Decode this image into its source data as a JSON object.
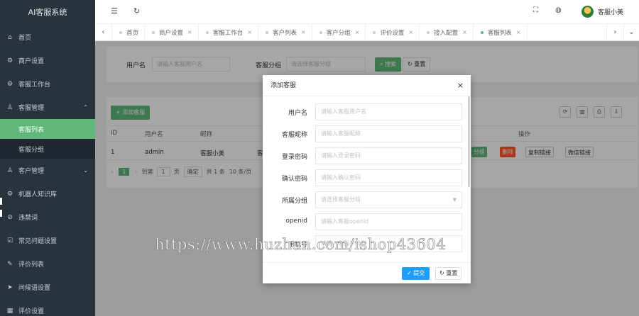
{
  "app": {
    "logo": "AI客服系统"
  },
  "sidebar": {
    "items": [
      {
        "icon": "⌂",
        "label": "首页"
      },
      {
        "icon": "⚙",
        "label": "商户设置"
      },
      {
        "icon": "⚙",
        "label": "客服工作台"
      },
      {
        "icon": "♙",
        "label": "客服管理",
        "arrow": "⌃"
      }
    ],
    "sub": [
      {
        "label": "客服列表"
      },
      {
        "label": "客服分组"
      }
    ],
    "items2": [
      {
        "icon": "♙",
        "label": "客户管理",
        "arrow": "⌄"
      },
      {
        "icon": "⚙",
        "label": "机器人知识库"
      },
      {
        "icon": "⊘",
        "label": "违禁词"
      },
      {
        "icon": "☑",
        "label": "常见问题设置"
      },
      {
        "icon": "✎",
        "label": "评价列表"
      },
      {
        "icon": "➤",
        "label": "问候语设置"
      },
      {
        "icon": "▦",
        "label": "评价设置"
      }
    ]
  },
  "header": {
    "menu_icon": "☰",
    "refresh_icon": "↻",
    "fullscreen_icon": "⛶",
    "globe_icon": "◍",
    "user_name": "客服小美"
  },
  "tabs": {
    "prev": "‹",
    "next": "›",
    "down": "⌄",
    "items": [
      {
        "label": "首页",
        "close": ""
      },
      {
        "label": "商户设置",
        "close": "×"
      },
      {
        "label": "客服工作台",
        "close": "×"
      },
      {
        "label": "客户列表",
        "close": "×"
      },
      {
        "label": "客户分组",
        "close": "×"
      },
      {
        "label": "评价设置",
        "close": "×"
      },
      {
        "label": "接入配置",
        "close": "×"
      },
      {
        "label": "客服列表",
        "close": "×"
      }
    ]
  },
  "search": {
    "username_label": "用户名",
    "username_placeholder": "请输入客服用户名",
    "group_label": "客服分组",
    "group_placeholder": "请选择客服分组",
    "search_button": "搜索",
    "reset_button": "重置"
  },
  "table": {
    "add_button": "+ 添加客服",
    "tools": [
      "⟳",
      "▥",
      "⎙",
      "⇩"
    ],
    "headers": {
      "id": "ID",
      "username": "用户名",
      "nickname": "昵称",
      "ops": "操作"
    },
    "row": {
      "id": "1",
      "username": "admin",
      "nickname": "客服小美",
      "partial": "客"
    },
    "ops": {
      "btn1": "分组",
      "delete": "删除",
      "copy": "复制链接",
      "copy2": "微信链接"
    },
    "pager": {
      "prev": "‹",
      "page": "1",
      "next": "›",
      "goto": "到第",
      "page_input": "1",
      "page_unit": "页",
      "confirm": "确定",
      "total": "共 1 条",
      "per_page": "10 条/页"
    }
  },
  "dialog": {
    "title": "添加客服",
    "close": "×",
    "fields": [
      {
        "label": "用户名",
        "placeholder": "请输入客服用户名"
      },
      {
        "label": "客服昵称",
        "placeholder": "请输入客服昵称"
      },
      {
        "label": "登录密码",
        "placeholder": "请输入登录密码"
      },
      {
        "label": "确认密码",
        "placeholder": "请输入确认密码"
      },
      {
        "label": "所属分组",
        "placeholder": "请选择客服分组",
        "select": true
      },
      {
        "label": "openid",
        "placeholder": "请输入客服openid"
      },
      {
        "label": "手机号",
        "placeholder": "请输入客服手机号"
      }
    ],
    "submit": "✓ 提交",
    "reset": "↻ 重置"
  },
  "watermark": "https://www.huzhan.com/ishop43604"
}
